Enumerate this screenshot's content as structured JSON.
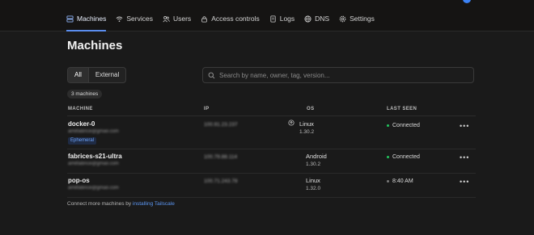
{
  "nav": {
    "items": [
      {
        "label": "Machines",
        "icon": "server-icon"
      },
      {
        "label": "Services",
        "icon": "wifi-icon"
      },
      {
        "label": "Users",
        "icon": "users-icon"
      },
      {
        "label": "Access controls",
        "icon": "lock-icon"
      },
      {
        "label": "Logs",
        "icon": "document-icon"
      },
      {
        "label": "DNS",
        "icon": "globe-icon"
      },
      {
        "label": "Settings",
        "icon": "gear-icon"
      }
    ],
    "active": "Machines"
  },
  "page": {
    "title": "Machines"
  },
  "filter": {
    "all": "All",
    "external": "External",
    "selected": "All"
  },
  "search": {
    "placeholder": "Search by name, owner, tag, version..."
  },
  "count_badge": "3 machines",
  "table": {
    "headers": {
      "machine": "MACHINE",
      "ip": "IP",
      "os": "OS",
      "last_seen": "LAST SEEN"
    },
    "rows": [
      {
        "name": "docker-0",
        "owner": "amitfabrice@gmail.com",
        "tag": "Ephemeral",
        "ip": "100.91.23.237",
        "os": "Linux",
        "os_version": "1.30.2",
        "update_available": true,
        "last_seen": "Connected",
        "status": "online"
      },
      {
        "name": "fabrices-s21-ultra",
        "owner": "amitfabrice@gmail.com",
        "tag": "",
        "ip": "100.79.88.114",
        "os": "Android",
        "os_version": "1.30.2",
        "update_available": false,
        "last_seen": "Connected",
        "status": "online"
      },
      {
        "name": "pop-os",
        "owner": "amitfabrice@gmail.com",
        "tag": "",
        "ip": "100.71.243.78",
        "os": "Linux",
        "os_version": "1.32.0",
        "update_available": false,
        "last_seen": "8:40 AM",
        "status": "offline"
      }
    ]
  },
  "footer": {
    "text": "Connect more machines by ",
    "link": "installing Tailscale"
  },
  "colors": {
    "accent": "#5a8dee",
    "online": "#22c55e",
    "offline": "#7a7a7a",
    "background": "#1a1a1a"
  }
}
